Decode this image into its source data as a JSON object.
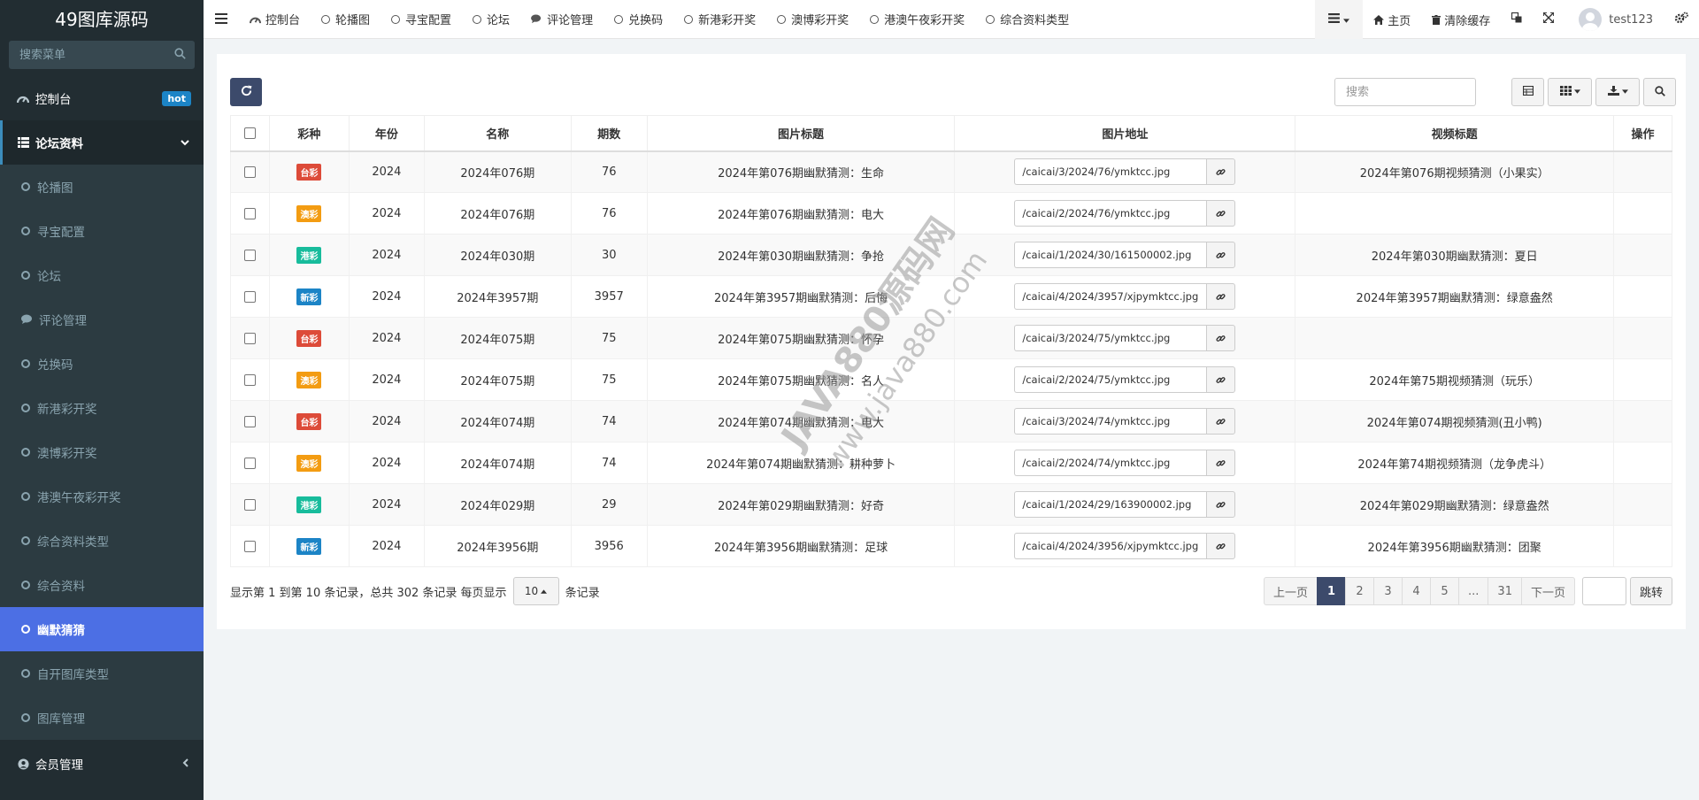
{
  "app": {
    "title": "49图库源码"
  },
  "sidebar": {
    "search_placeholder": "搜索菜单",
    "dashboard": {
      "label": "控制台",
      "badge": "hot"
    },
    "forum_group": {
      "label": "论坛资料"
    },
    "items": [
      {
        "label": "轮播图"
      },
      {
        "label": "寻宝配置"
      },
      {
        "label": "论坛"
      },
      {
        "label": "评论管理"
      },
      {
        "label": "兑换码"
      },
      {
        "label": "新港彩开奖"
      },
      {
        "label": "澳博彩开奖"
      },
      {
        "label": "港澳午夜彩开奖"
      },
      {
        "label": "综合资料类型"
      },
      {
        "label": "综合资料"
      },
      {
        "label": "幽默猜猜"
      },
      {
        "label": "自开图库类型"
      },
      {
        "label": "图库管理"
      }
    ],
    "member": {
      "label": "会员管理"
    }
  },
  "topnav": {
    "tabs": [
      {
        "label": "控制台",
        "icon": "dashboard-icon"
      },
      {
        "label": "轮播图",
        "icon": "circle-icon"
      },
      {
        "label": "寻宝配置",
        "icon": "circle-icon"
      },
      {
        "label": "论坛",
        "icon": "circle-icon"
      },
      {
        "label": "评论管理",
        "icon": "comments-icon"
      },
      {
        "label": "兑换码",
        "icon": "circle-icon"
      },
      {
        "label": "新港彩开奖",
        "icon": "circle-icon"
      },
      {
        "label": "澳博彩开奖",
        "icon": "circle-icon"
      },
      {
        "label": "港澳午夜彩开奖",
        "icon": "circle-icon"
      },
      {
        "label": "综合资料类型",
        "icon": "circle-icon"
      }
    ],
    "home": "主页",
    "clear_cache": "清除缓存",
    "username": "test123"
  },
  "toolbar": {
    "search_placeholder": "搜索"
  },
  "table": {
    "columns": [
      "彩种",
      "年份",
      "名称",
      "期数",
      "图片标题",
      "图片地址",
      "视频标题",
      "操作"
    ],
    "rows": [
      {
        "tag": "台彩",
        "tag_color": "#dd4b39",
        "year": "2024",
        "name": "2024年076期",
        "issue": "76",
        "img_title": "2024年第076期幽默猜测：生命",
        "img_url": "/caicai/3/2024/76/ymktcc.jpg",
        "video_title": "2024年第076期视频猜测（小果实）"
      },
      {
        "tag": "澳彩",
        "tag_color": "#f39c12",
        "year": "2024",
        "name": "2024年076期",
        "issue": "76",
        "img_title": "2024年第076期幽默猜测：电大",
        "img_url": "/caicai/2/2024/76/ymktcc.jpg",
        "video_title": ""
      },
      {
        "tag": "港彩",
        "tag_color": "#18bc9c",
        "year": "2024",
        "name": "2024年030期",
        "issue": "30",
        "img_title": "2024年第030期幽默猜测：争抢",
        "img_url": "/caicai/1/2024/30/161500002.jpg",
        "video_title": "2024年第030期幽默猜测：夏日"
      },
      {
        "tag": "新彩",
        "tag_color": "#1c84c6",
        "year": "2024",
        "name": "2024年3957期",
        "issue": "3957",
        "img_title": "2024年第3957期幽默猜测：后悔",
        "img_url": "/caicai/4/2024/3957/xjpymktcc.jpg",
        "video_title": "2024年第3957期幽默猜测：绿意盎然"
      },
      {
        "tag": "台彩",
        "tag_color": "#dd4b39",
        "year": "2024",
        "name": "2024年075期",
        "issue": "75",
        "img_title": "2024年第075期幽默猜测：怀孕",
        "img_url": "/caicai/3/2024/75/ymktcc.jpg",
        "video_title": ""
      },
      {
        "tag": "澳彩",
        "tag_color": "#f39c12",
        "year": "2024",
        "name": "2024年075期",
        "issue": "75",
        "img_title": "2024年第075期幽默猜测：名人",
        "img_url": "/caicai/2/2024/75/ymktcc.jpg",
        "video_title": "2024年第75期视频猜测（玩乐）"
      },
      {
        "tag": "台彩",
        "tag_color": "#dd4b39",
        "year": "2024",
        "name": "2024年074期",
        "issue": "74",
        "img_title": "2024年第074期幽默猜测：电大",
        "img_url": "/caicai/3/2024/74/ymktcc.jpg",
        "video_title": "2024年第074期视频猜测(丑小鸭)"
      },
      {
        "tag": "澳彩",
        "tag_color": "#f39c12",
        "year": "2024",
        "name": "2024年074期",
        "issue": "74",
        "img_title": "2024年第074期幽默猜测：耕种萝卜",
        "img_url": "/caicai/2/2024/74/ymktcc.jpg",
        "video_title": "2024年第74期视频猜测（龙争虎斗）"
      },
      {
        "tag": "港彩",
        "tag_color": "#18bc9c",
        "year": "2024",
        "name": "2024年029期",
        "issue": "29",
        "img_title": "2024年第029期幽默猜测：好奇",
        "img_url": "/caicai/1/2024/29/163900002.jpg",
        "video_title": "2024年第029期幽默猜测：绿意盎然"
      },
      {
        "tag": "新彩",
        "tag_color": "#1c84c6",
        "year": "2024",
        "name": "2024年3956期",
        "issue": "3956",
        "img_title": "2024年第3956期幽默猜测：足球",
        "img_url": "/caicai/4/2024/3956/xjpymktcc.jpg",
        "video_title": "2024年第3956期幽默猜测：团聚"
      }
    ]
  },
  "footer": {
    "info": "显示第 1 到第 10 条记录，总共 302 条记录 每页显示",
    "page_size": "10",
    "suffix": "条记录"
  },
  "pagination": {
    "prev": "上一页",
    "pages": [
      "1",
      "2",
      "3",
      "4",
      "5",
      "...",
      "31"
    ],
    "next": "下一页",
    "jump": "跳转"
  },
  "watermark": {
    "line1": "JAVA880源码网",
    "line2": "www.java880.com"
  }
}
